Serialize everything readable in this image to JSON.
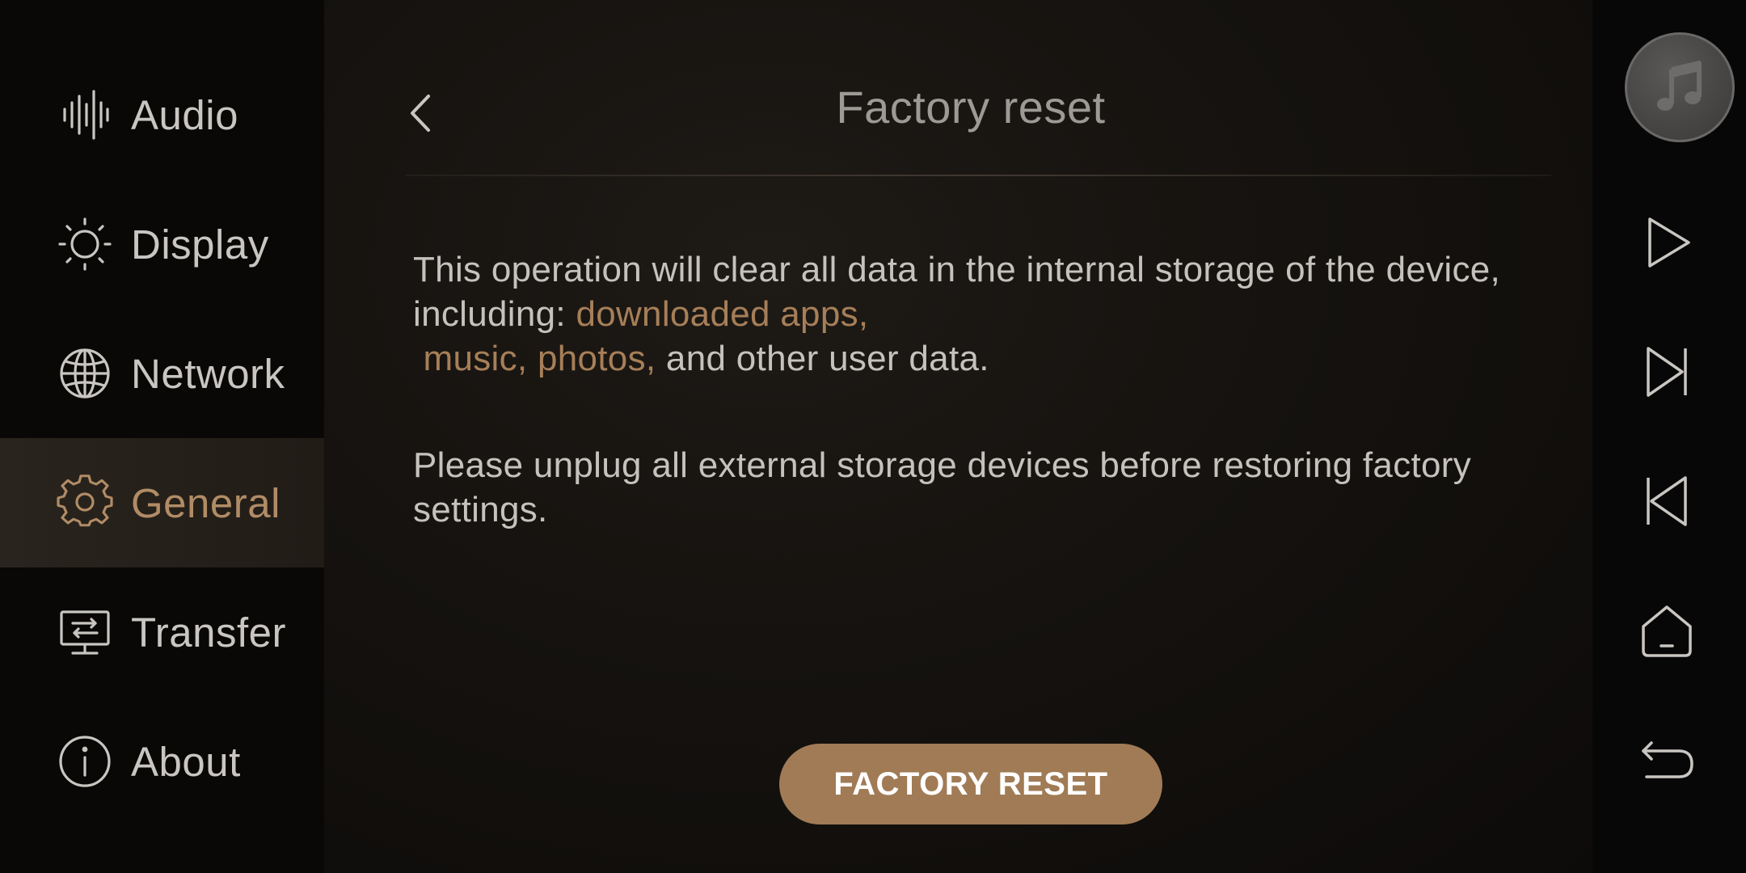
{
  "sidebar": {
    "items": [
      {
        "label": "Audio",
        "icon": "audio-waveform-icon",
        "active": false
      },
      {
        "label": "Display",
        "icon": "sun-icon",
        "active": false
      },
      {
        "label": "Network",
        "icon": "globe-icon",
        "active": false
      },
      {
        "label": "General",
        "icon": "gear-icon",
        "active": true
      },
      {
        "label": "Transfer",
        "icon": "transfer-monitor-icon",
        "active": false
      },
      {
        "label": "About",
        "icon": "info-icon",
        "active": false
      }
    ]
  },
  "header": {
    "title": "Factory reset",
    "back_icon": "chevron-left-icon"
  },
  "content": {
    "paragraph1": {
      "text_a": "This operation will clear all data in the internal storage of the device, including: ",
      "highlight_a": "downloaded apps,",
      "highlight_b": " music, photos,",
      "text_b": " and other user data."
    },
    "paragraph2": "Please unplug all external storage devices before restoring factory settings.",
    "button_label": "FACTORY RESET"
  },
  "controls": {
    "items": [
      "music-note-icon",
      "play-icon",
      "skip-next-icon",
      "skip-previous-icon",
      "home-icon",
      "back-return-icon"
    ]
  },
  "colors": {
    "accent": "#a07b55",
    "highlight_text": "#a67f58",
    "text": "#c5c2be",
    "active_bg": "#2a241e"
  }
}
